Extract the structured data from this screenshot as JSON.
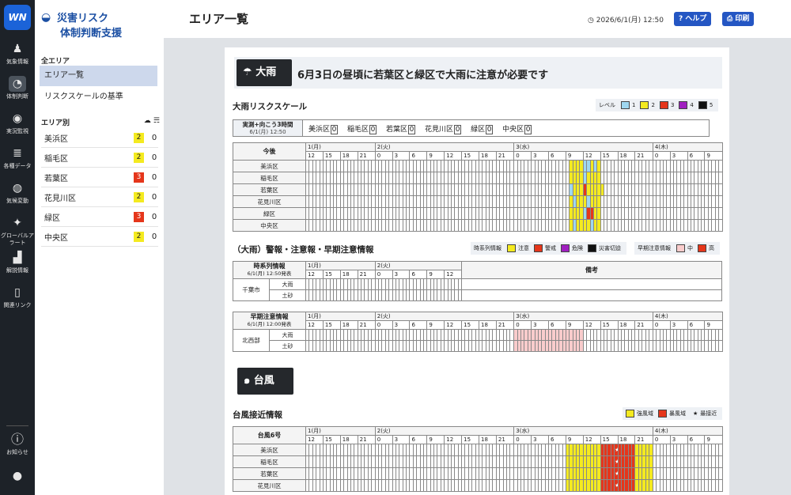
{
  "rail": [
    {
      "label": "気象情報",
      "icon": "person-pin-icon",
      "glyph": "♟"
    },
    {
      "label": "体制判断",
      "icon": "gauge-icon",
      "glyph": "◔",
      "active": true
    },
    {
      "label": "実況監視",
      "icon": "monitor-icon",
      "glyph": "◉"
    },
    {
      "label": "各種データ",
      "icon": "database-icon",
      "glyph": "≣"
    },
    {
      "label": "気候変動",
      "icon": "globe-icon",
      "glyph": "◍"
    },
    {
      "label": "グローバルアラート",
      "icon": "global-alert-icon",
      "glyph": "✦"
    },
    {
      "label": "解説情報",
      "icon": "chart-icon",
      "glyph": "▟"
    },
    {
      "label": "関連リンク",
      "icon": "book-icon",
      "glyph": "▯"
    }
  ],
  "rail_bottom": {
    "notice_label": "お知らせ",
    "notice_glyph": "ⓘ",
    "user_glyph": "●"
  },
  "logo_text": "WN",
  "brand": {
    "line1": "災害リスク",
    "line2": "体制判断支援",
    "icon_glyph": "◒"
  },
  "sidebar": {
    "all_area_label": "全エリア",
    "nav": [
      "エリア一覧",
      "リスクスケールの基準"
    ],
    "area_label": "エリア別",
    "area_icon1": "☁",
    "area_icon2": "☴",
    "areas": [
      {
        "name": "美浜区",
        "level": "2",
        "count": "0"
      },
      {
        "name": "稲毛区",
        "level": "2",
        "count": "0"
      },
      {
        "name": "若葉区",
        "level": "3",
        "count": "0"
      },
      {
        "name": "花見川区",
        "level": "2",
        "count": "0"
      },
      {
        "name": "緑区",
        "level": "3",
        "count": "0"
      },
      {
        "name": "中央区",
        "level": "2",
        "count": "0"
      }
    ]
  },
  "header": {
    "title": "エリア一覧",
    "datetime": "2026/6/1(月) 12:50",
    "clock_glyph": "◷",
    "help": "? ヘルプ",
    "print": "⎙ 印刷"
  },
  "rain": {
    "badge": "大雨",
    "badge_glyph": "☂",
    "message": "6月3日の昼頃に若葉区と緑区で大雨に注意が必要です",
    "scale_title": "大雨リスクスケール",
    "scale_legend_label": "レベル",
    "scale_legend": [
      {
        "label": "1",
        "color": "#9fd7f0"
      },
      {
        "label": "2",
        "color": "#f4ea20"
      },
      {
        "label": "3",
        "color": "#e5361b"
      },
      {
        "label": "4",
        "color": "#a020c0"
      },
      {
        "label": "5",
        "color": "#111111"
      }
    ],
    "now_label": "実測+向こう3時間",
    "now_time": "6/1(月) 12:50",
    "now_items": [
      {
        "name": "美浜区",
        "val": "0"
      },
      {
        "name": "稲毛区",
        "val": "0"
      },
      {
        "name": "若葉区",
        "val": "0"
      },
      {
        "name": "花見川区",
        "val": "0"
      },
      {
        "name": "緑区",
        "val": "0"
      },
      {
        "name": "中央区",
        "val": "0"
      }
    ],
    "grid_label": "今後",
    "days": [
      "1(月)",
      "2(火)",
      "3(水)",
      "4(木)"
    ],
    "hours": [
      "12",
      "15",
      "18",
      "21",
      "0",
      "3",
      "6",
      "9",
      "12",
      "15",
      "18",
      "21",
      "0",
      "3",
      "6",
      "9",
      "12",
      "15",
      "18",
      "21",
      "0",
      "3",
      "6",
      "9"
    ],
    "rows": [
      {
        "name": "美浜区",
        "cells": "0000000000000000000000000000000000000000000000000000000000000000000000000000222211212000000000000000000000000000000000000"
      },
      {
        "name": "稲毛区",
        "cells": "0000000000000000000000000000000000000000000000000000000000000000000000000000222212222000000000000000000000000000000000000"
      },
      {
        "name": "若葉区",
        "cells": "0000000000000000000000000000000000000000000000000000000000000000000000000000122232222200000000000000000000000000000000000"
      },
      {
        "name": "花見川区",
        "cells": "0000000000000000000000000000000000000000000000000000000000000000000000000000212221222000000000000000000000000000000000000"
      },
      {
        "name": "緑区",
        "cells": "0000000000000000000000000000000000000000000000000000000000000000000000000000222213322000000000000000000000000000000000000"
      },
      {
        "name": "中央区",
        "cells": "0000000000000000000000000000000000000000000000000000000000000000000000000000212222122000000000000000000000000000000000000"
      }
    ],
    "warn_title": "（大雨）警報・注意報・早期注意情報",
    "warn_legend1_label": "時系列情報",
    "warn_legend1": [
      {
        "label": "注意",
        "color": "#f4ea20"
      },
      {
        "label": "警戒",
        "color": "#e5361b"
      },
      {
        "label": "危険",
        "color": "#a020c0"
      },
      {
        "label": "災害切迫",
        "color": "#111111"
      }
    ],
    "warn_legend2_label": "早期注意情報",
    "warn_legend2": [
      {
        "label": "中",
        "color": "#f9cccc"
      },
      {
        "label": "高",
        "color": "#e5361b"
      }
    ],
    "ts_label": "時系列情報",
    "ts_time": "6/1(月) 12:50発表",
    "ts_city": "千葉市",
    "ts_rows": [
      "大雨",
      "土砂"
    ],
    "ts_days": [
      "1(月)",
      "2(火)"
    ],
    "ts_hours": [
      "12",
      "15",
      "18",
      "21",
      "0",
      "3",
      "6",
      "9",
      "12"
    ],
    "ts_note": "備考",
    "early_label": "早期注意情報",
    "early_time": "6/1(月) 12:00発表",
    "early_region": "北西部",
    "early_rows": [
      "大雨",
      "土砂"
    ]
  },
  "typhoon": {
    "badge": "台風",
    "badge_glyph": "๑",
    "title": "台風接近情報",
    "legend": [
      {
        "label": "強風域",
        "color": "#f4ea20"
      },
      {
        "label": "暴風域",
        "color": "#e5361b"
      },
      {
        "label": "最接近",
        "glyph": "★"
      }
    ],
    "grid_label": "台風6号",
    "rows": [
      "美浜区",
      "稲毛区",
      "若葉区",
      "花見川区"
    ]
  }
}
